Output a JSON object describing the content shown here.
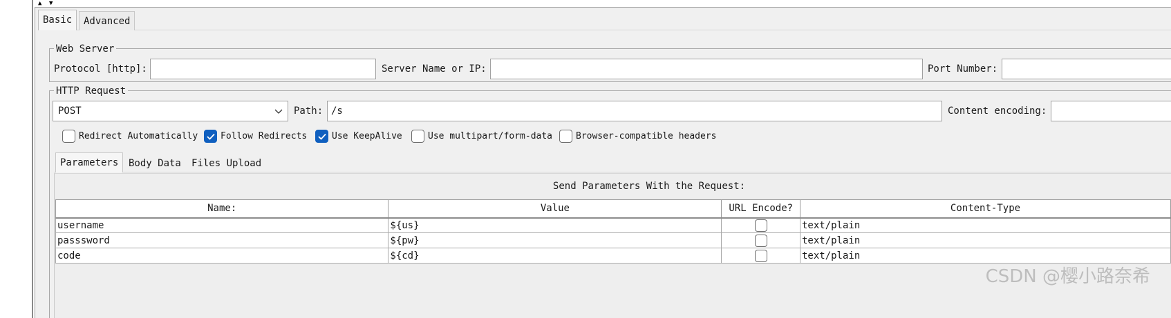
{
  "tabs": {
    "basic": "Basic",
    "advanced": "Advanced"
  },
  "web_server": {
    "group_title": "Web Server",
    "protocol_label": "Protocol [http]:",
    "protocol_value": "",
    "server_label": "Server Name or IP:",
    "server_value": "",
    "port_label": "Port Number:",
    "port_value": ""
  },
  "http_request": {
    "group_title": "HTTP Request",
    "method": "POST",
    "path_label": "Path:",
    "path_value": "/s",
    "encoding_label": "Content encoding:",
    "encoding_value": ""
  },
  "options": [
    {
      "label": "Redirect Automatically",
      "checked": false
    },
    {
      "label": "Follow Redirects",
      "checked": true
    },
    {
      "label": "Use KeepAlive",
      "checked": true
    },
    {
      "label": "Use multipart/form-data",
      "checked": false
    },
    {
      "label": "Browser-compatible headers",
      "checked": false
    }
  ],
  "inner_tabs": {
    "parameters": "Parameters",
    "body_data": "Body Data",
    "files_upload": "Files Upload"
  },
  "params": {
    "caption": "Send Parameters With the Request:",
    "columns": [
      "Name:",
      "Value",
      "URL Encode?",
      "Content-Type"
    ],
    "rows": [
      {
        "name": "username",
        "value": "${us}",
        "url_encode": false,
        "content_type": "text/plain"
      },
      {
        "name": "passsword",
        "value": "${pw}",
        "url_encode": false,
        "content_type": "text/plain"
      },
      {
        "name": "code",
        "value": "${cd}",
        "url_encode": false,
        "content_type": "text/plain"
      }
    ]
  },
  "watermark": "CSDN @樱小路奈希",
  "colors": {
    "panel_bg": "#f0f0f0",
    "checkbox_on": "#0f5fbf",
    "border": "#a0a0a0"
  },
  "icons": [
    "collapse-up-icon",
    "collapse-down-icon",
    "chevron-down-icon",
    "check-icon"
  ]
}
